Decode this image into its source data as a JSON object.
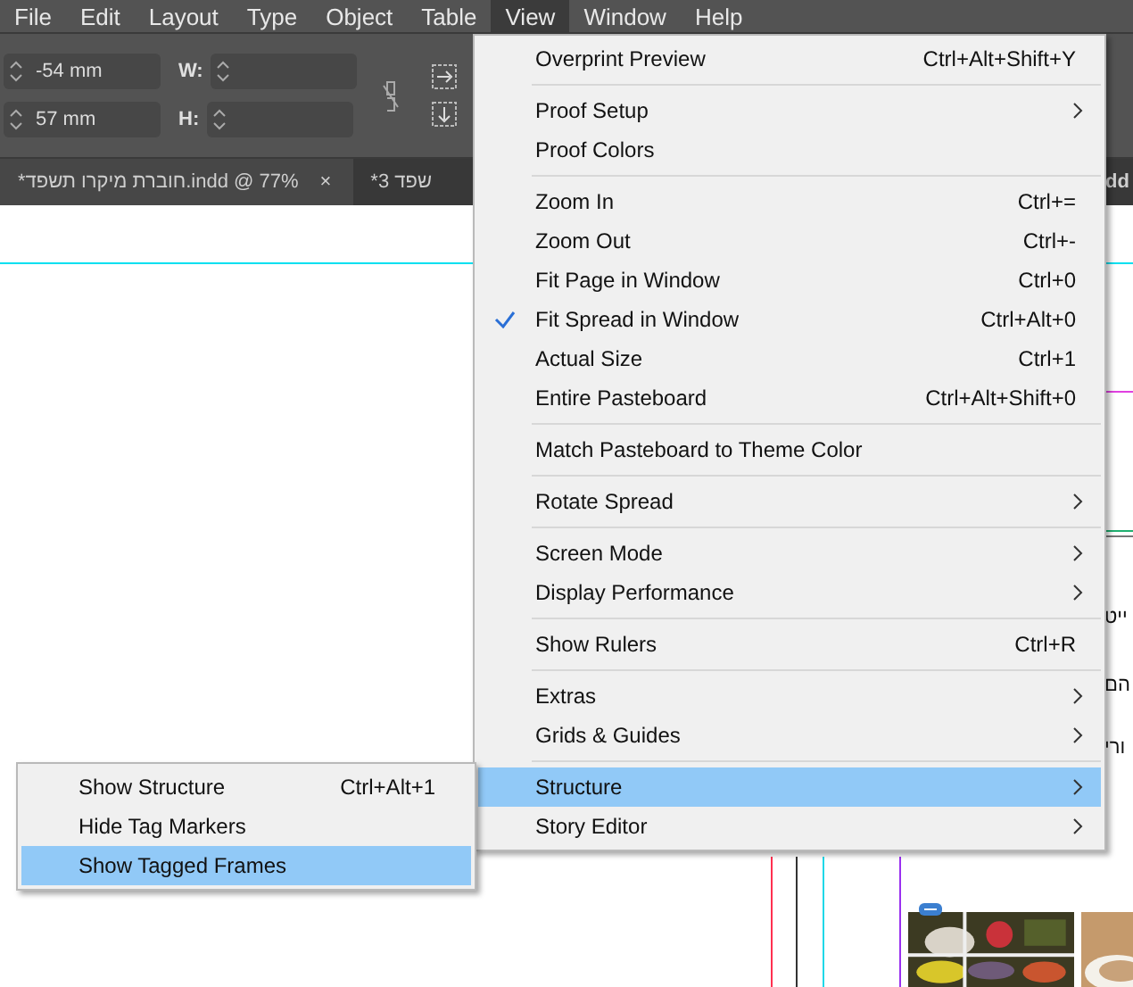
{
  "menubar": [
    {
      "label": "File",
      "selected": false
    },
    {
      "label": "Edit",
      "selected": false
    },
    {
      "label": "Layout",
      "selected": false
    },
    {
      "label": "Type",
      "selected": false
    },
    {
      "label": "Object",
      "selected": false
    },
    {
      "label": "Table",
      "selected": false
    },
    {
      "label": "View",
      "selected": true
    },
    {
      "label": "Window",
      "selected": false
    },
    {
      "label": "Help",
      "selected": false
    }
  ],
  "control_bar": {
    "x_value": "-54 mm",
    "y_value": "57 mm",
    "w_label": "W:",
    "h_label": "H:"
  },
  "tab_bar": {
    "first_tab": {
      "label": "*חוברת מיקרו תשפד.indd @ 77%",
      "close": "×",
      "selected": true
    },
    "second_tab": {
      "label": "*3 שפד",
      "selected": false
    },
    "third_tab": {
      "label": "dd",
      "selected": false
    }
  },
  "view_menu": [
    {
      "kind": "item",
      "label": "Overprint Preview",
      "shortcut": "Ctrl+Alt+Shift+Y",
      "submenu": false,
      "checked": false,
      "selected": false
    },
    {
      "kind": "separator"
    },
    {
      "kind": "item",
      "label": "Proof Setup",
      "submenu": true,
      "checked": false,
      "selected": false
    },
    {
      "kind": "item",
      "label": "Proof Colors",
      "submenu": false,
      "checked": false,
      "selected": false
    },
    {
      "kind": "separator"
    },
    {
      "kind": "item",
      "label": "Zoom In",
      "shortcut": "Ctrl+=",
      "submenu": false,
      "checked": false,
      "selected": false
    },
    {
      "kind": "item",
      "label": "Zoom Out",
      "shortcut": "Ctrl+-",
      "submenu": false,
      "checked": false,
      "selected": false
    },
    {
      "kind": "item",
      "label": "Fit Page in Window",
      "shortcut": "Ctrl+0",
      "submenu": false,
      "checked": false,
      "selected": false
    },
    {
      "kind": "item",
      "label": "Fit Spread in Window",
      "shortcut": "Ctrl+Alt+0",
      "submenu": false,
      "checked": true,
      "selected": false
    },
    {
      "kind": "item",
      "label": "Actual Size",
      "shortcut": "Ctrl+1",
      "submenu": false,
      "checked": false,
      "selected": false
    },
    {
      "kind": "item",
      "label": "Entire Pasteboard",
      "shortcut": "Ctrl+Alt+Shift+0",
      "submenu": false,
      "checked": false,
      "selected": false
    },
    {
      "kind": "separator"
    },
    {
      "kind": "item",
      "label": "Match Pasteboard to Theme Color",
      "submenu": false,
      "checked": false,
      "selected": false
    },
    {
      "kind": "separator"
    },
    {
      "kind": "item",
      "label": "Rotate Spread",
      "submenu": true,
      "checked": false,
      "selected": false
    },
    {
      "kind": "separator"
    },
    {
      "kind": "item",
      "label": "Screen Mode",
      "submenu": true,
      "checked": false,
      "selected": false
    },
    {
      "kind": "item",
      "label": "Display Performance",
      "submenu": true,
      "checked": false,
      "selected": false
    },
    {
      "kind": "separator"
    },
    {
      "kind": "item",
      "label": "Show Rulers",
      "shortcut": "Ctrl+R",
      "submenu": false,
      "checked": false,
      "selected": false
    },
    {
      "kind": "separator"
    },
    {
      "kind": "item",
      "label": "Extras",
      "submenu": true,
      "checked": false,
      "selected": false
    },
    {
      "kind": "item",
      "label": "Grids & Guides",
      "submenu": true,
      "checked": false,
      "selected": false
    },
    {
      "kind": "separator"
    },
    {
      "kind": "item",
      "label": "Structure",
      "submenu": true,
      "checked": false,
      "selected": true
    },
    {
      "kind": "item",
      "label": "Story Editor",
      "submenu": true,
      "checked": false,
      "selected": false
    }
  ],
  "structure_submenu": [
    {
      "label": "Show Structure",
      "shortcut": "Ctrl+Alt+1",
      "selected": false
    },
    {
      "label": "Hide Tag Markers",
      "selected": false
    },
    {
      "label": "Show Tagged Frames",
      "selected": true
    }
  ],
  "page_text_fragments": [
    "ייט",
    "הם",
    "ורי"
  ]
}
